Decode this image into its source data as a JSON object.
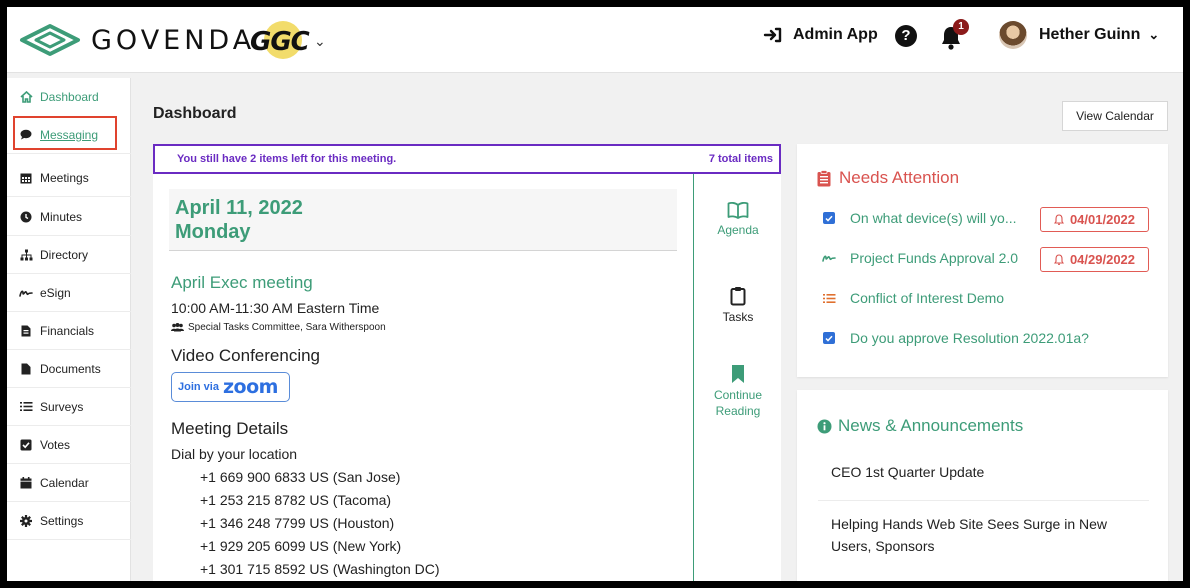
{
  "header": {
    "logo_text": "GOVENDA",
    "org_badge": "GGC",
    "admin_label": "Admin App",
    "help_label": "?",
    "notifications_count": "1",
    "user_name": "Hether Guinn"
  },
  "sidebar": {
    "items": [
      {
        "label": "Dashboard",
        "icon": "home-icon"
      },
      {
        "label": "Messaging",
        "icon": "comment-icon"
      },
      {
        "label": "Meetings",
        "icon": "calendar-grid-icon"
      },
      {
        "label": "Minutes",
        "icon": "clock-icon"
      },
      {
        "label": "Directory",
        "icon": "sitemap-icon"
      },
      {
        "label": "eSign",
        "icon": "signature-icon"
      },
      {
        "label": "Financials",
        "icon": "file-invoice-icon"
      },
      {
        "label": "Documents",
        "icon": "file-icon"
      },
      {
        "label": "Surveys",
        "icon": "list-icon"
      },
      {
        "label": "Votes",
        "icon": "checkbox-icon"
      },
      {
        "label": "Calendar",
        "icon": "calendar-icon"
      },
      {
        "label": "Settings",
        "icon": "cog-icon"
      }
    ]
  },
  "main": {
    "title": "Dashboard",
    "view_calendar": "View Calendar"
  },
  "meeting": {
    "banner_left": "You still have 2 items left for this meeting.",
    "banner_right": "7 total items",
    "date": "April 11, 2022",
    "weekday": "Monday",
    "title": "April Exec meeting",
    "time": "10:00 AM-11:30 AM  Eastern Time",
    "committee": "Special Tasks Committee, Sara Witherspoon",
    "video_title": "Video Conferencing",
    "join_label": "Join via",
    "zoom_label": "zoom",
    "details_title": "Meeting Details",
    "dial_label": "Dial by your location",
    "phones": [
      "+1 669 900 6833 US (San Jose)",
      "+1 253 215 8782 US (Tacoma)",
      "+1 346 248 7799 US (Houston)",
      "+1 929 205 6099 US (New York)",
      "+1 301 715 8592 US (Washington DC)"
    ],
    "side": {
      "agenda": "Agenda",
      "tasks": "Tasks",
      "continue_line1": "Continue",
      "continue_line2": "Reading"
    }
  },
  "needs_attention": {
    "title": "Needs Attention",
    "items": [
      {
        "label": "On what device(s) will yo...",
        "icon": "checkbox-icon",
        "due": "04/01/2022"
      },
      {
        "label": "Project Funds Approval 2.0",
        "icon": "signature-icon",
        "due": "04/29/2022"
      },
      {
        "label": "Conflict of Interest Demo",
        "icon": "list-icon"
      },
      {
        "label": "Do you approve Resolution 2022.01a?",
        "icon": "checkbox-icon"
      }
    ]
  },
  "news": {
    "title": "News & Announcements",
    "items": [
      "CEO 1st Quarter Update",
      "Helping Hands Web Site Sees Surge in New",
      "Users, Sponsors"
    ]
  },
  "colors": {
    "accent": "#3d9c78",
    "alert": "#d9534f",
    "banner": "#6a2bc2",
    "highlight_box": "#e0432e",
    "zoom": "#2d6fe0"
  }
}
